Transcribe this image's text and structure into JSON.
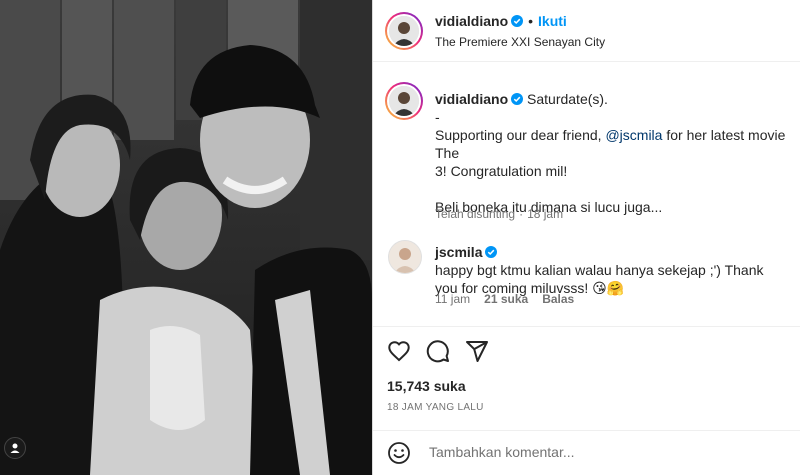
{
  "post": {
    "author": "vidialdiano",
    "follow_label": "Ikuti",
    "dot": "•",
    "location": "The Premiere XXI Senayan City"
  },
  "caption": {
    "author": "vidialdiano",
    "first_line": "Saturdate(s).",
    "dash": "-",
    "para1_before": "Supporting our dear friend, ",
    "mention": "@jscmila",
    "para1_after": " for her latest movie The",
    "para1_line2": "3! Congratulation mil!",
    "para2": "Beli boneka itu dimana si lucu juga...",
    "edited": "Telah disunting",
    "sep": "·",
    "time": "18 jam"
  },
  "reply": {
    "author": "jscmila",
    "text_line1": "happy bgt ktmu kalian walau hanya sekejap ;') Thank",
    "text_line2": "you for coming miluvsss! 😘🤗",
    "time": "11 jam",
    "likes": "21 suka",
    "reply_label": "Balas"
  },
  "actions": {
    "like_icon": "heart-icon",
    "comment_icon": "comment-icon",
    "share_icon": "share-icon"
  },
  "stats": {
    "likes": "15,743 suka",
    "time_ago": "18 JAM YANG LALU"
  },
  "add_comment": {
    "placeholder": "Tambahkan komentar..."
  },
  "colors": {
    "accent": "#0095f6",
    "verified": "#0095f6",
    "mention": "#00376b",
    "muted": "#737373"
  }
}
